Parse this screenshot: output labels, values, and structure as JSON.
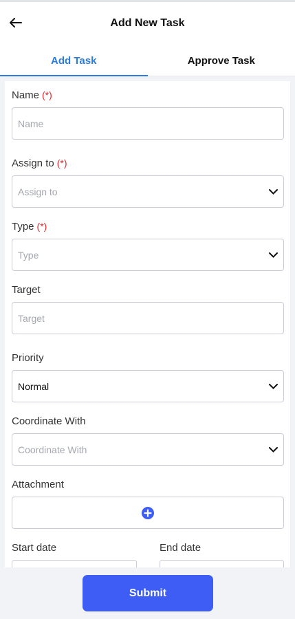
{
  "header": {
    "title": "Add New Task"
  },
  "tabs": [
    {
      "label": "Add Task",
      "active": true
    },
    {
      "label": "Approve Task",
      "active": false
    }
  ],
  "form": {
    "required_marker": "(*)",
    "name": {
      "label": "Name",
      "placeholder": "Name",
      "required": true
    },
    "assign_to": {
      "label": "Assign to",
      "placeholder": "Assign to",
      "required": true
    },
    "type": {
      "label": "Type",
      "placeholder": "Type",
      "required": true
    },
    "target": {
      "label": "Target",
      "placeholder": "Target",
      "required": false
    },
    "priority": {
      "label": "Priority",
      "value": "Normal",
      "required": false
    },
    "coordinate_with": {
      "label": "Coordinate With",
      "placeholder": "Coordinate With",
      "required": false
    },
    "attachment": {
      "label": "Attachment",
      "icon": "plus-circle-icon"
    },
    "start_date": {
      "label": "Start date"
    },
    "end_date": {
      "label": "End date"
    }
  },
  "footer": {
    "submit_label": "Submit"
  },
  "colors": {
    "accent": "#2c7be0",
    "button": "#3d5df5",
    "required": "#e0262b"
  }
}
